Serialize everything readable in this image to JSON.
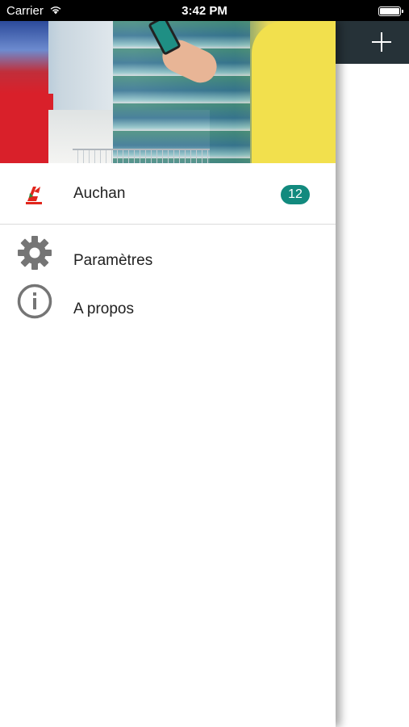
{
  "status_bar": {
    "carrier": "Carrier",
    "time": "3:42 PM"
  },
  "background_toolbar": {
    "color": "#263238",
    "action_icon": "plus-icon"
  },
  "drawer": {
    "items": [
      {
        "label": "Auchan",
        "icon": "auchan-logo",
        "badge": "12",
        "badge_color": "#128a7e"
      },
      {
        "label": "Paramètres",
        "icon": "gear-icon"
      },
      {
        "label": "A propos",
        "icon": "info-icon"
      }
    ]
  }
}
